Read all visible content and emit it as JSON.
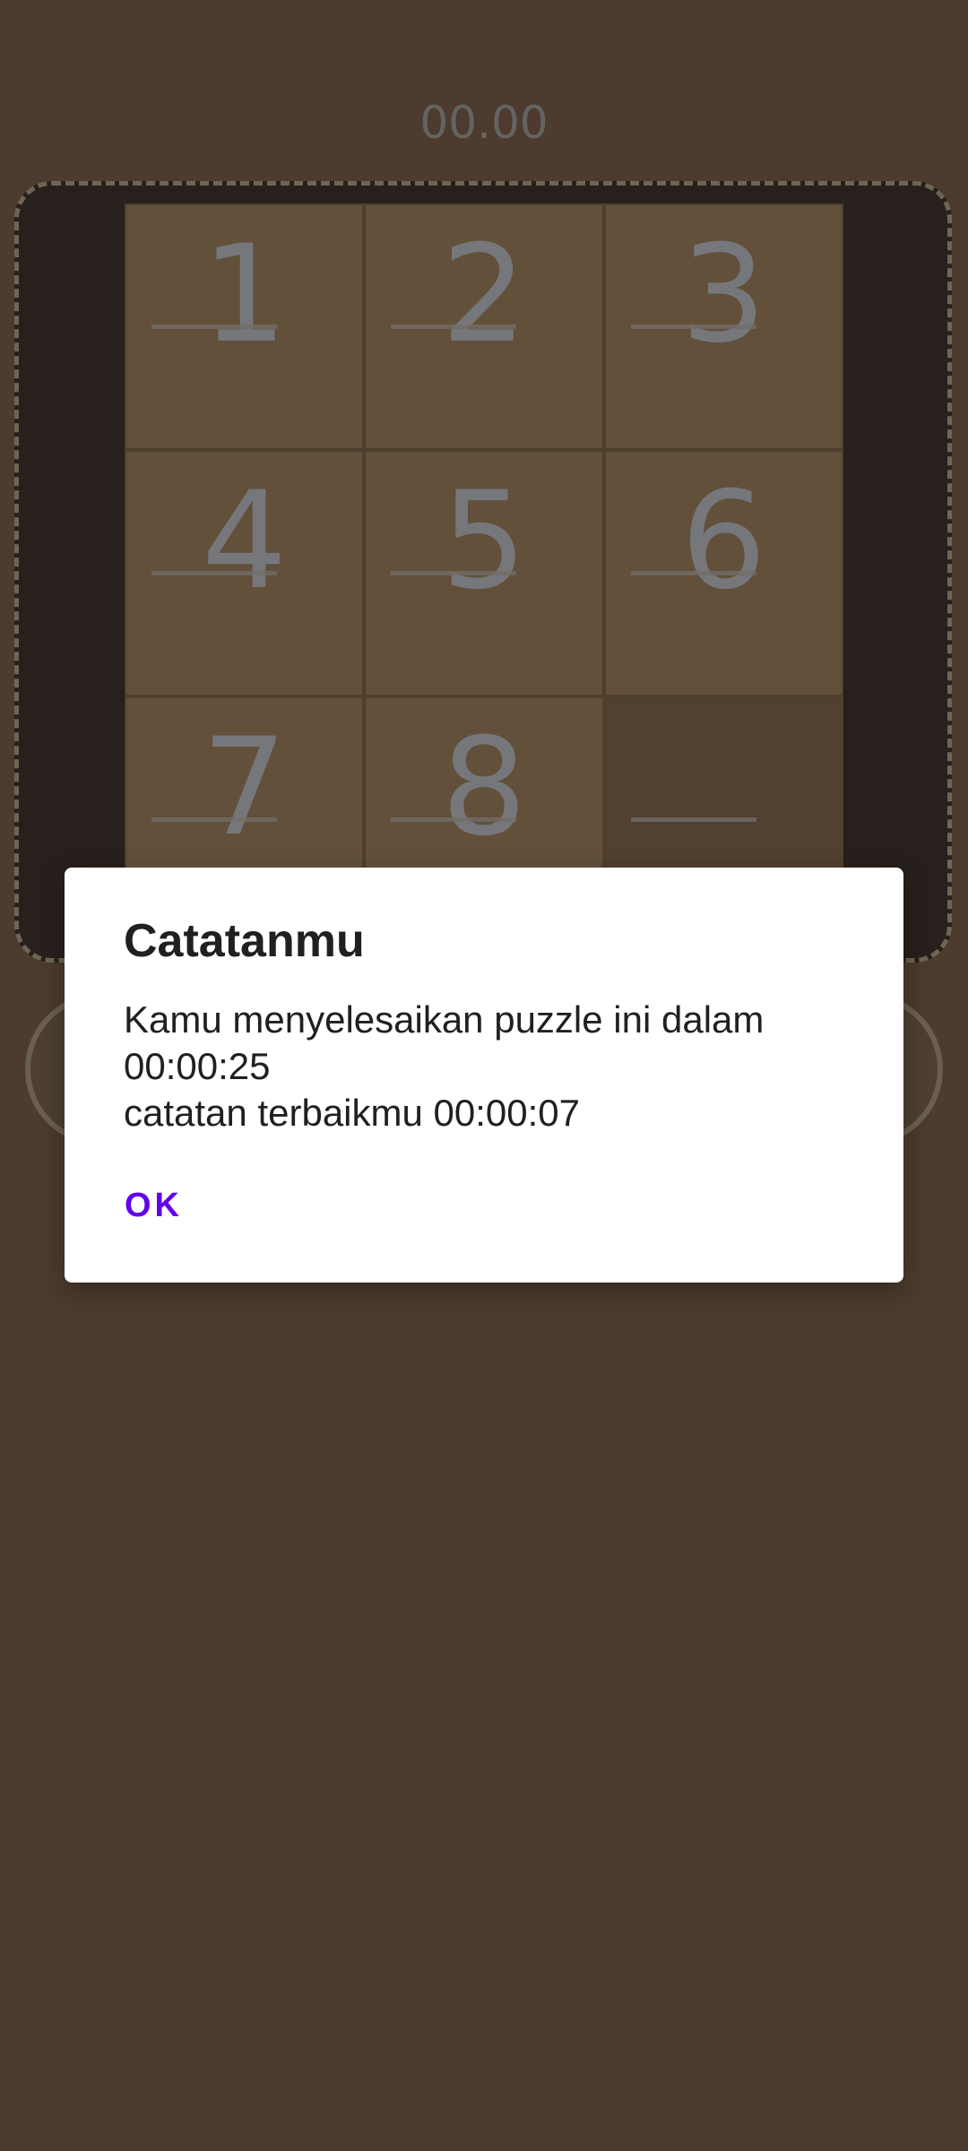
{
  "game": {
    "timer": "00.00",
    "tiles": [
      {
        "label": "1",
        "empty": false
      },
      {
        "label": "2",
        "empty": false
      },
      {
        "label": "3",
        "empty": false
      },
      {
        "label": "4",
        "empty": false
      },
      {
        "label": "5",
        "empty": false
      },
      {
        "label": "6",
        "empty": false
      },
      {
        "label": "7",
        "empty": false
      },
      {
        "label": "8",
        "empty": false
      },
      {
        "label": "",
        "empty": true
      }
    ]
  },
  "dialog": {
    "title": "Catatanmu",
    "message": "Kamu menyelesaikan puzzle ini dalam\n00:00:25\ncatatan terbaikmu 00:00:07",
    "ok_label": "OK"
  },
  "colors": {
    "accent": "#6200ee",
    "dialog_background": "#ffffff",
    "board_frame": "#4a3b35",
    "tile": "#b3926b"
  }
}
